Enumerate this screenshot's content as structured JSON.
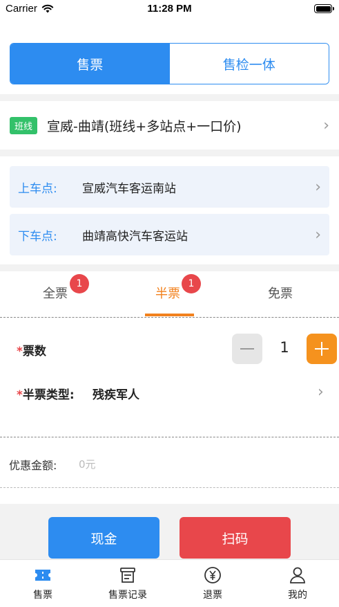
{
  "status_bar": {
    "carrier": "Carrier",
    "time": "11:28 PM"
  },
  "mode_tabs": [
    {
      "label": "售票",
      "active": true
    },
    {
      "label": "售检一体",
      "active": false
    }
  ],
  "route": {
    "tag": "班线",
    "name": "宣威-曲靖(班线+多站点+一口价)"
  },
  "stops": {
    "board_label": "上车点:",
    "board_value": "宣威汽车客运南站",
    "alight_label": "下车点:",
    "alight_value": "曲靖高快汽车客运站"
  },
  "ticket_tabs": [
    {
      "label": "全票",
      "badge": "1",
      "active": false
    },
    {
      "label": "半票",
      "badge": "1",
      "active": true
    },
    {
      "label": "免票",
      "badge": "",
      "active": false
    }
  ],
  "form": {
    "required_mark": "*",
    "count_label": "票数",
    "count_value": "1",
    "half_type_label": "半票类型:",
    "half_type_value": "残疾军人"
  },
  "discount": {
    "label": "优惠金额:",
    "value": "0元"
  },
  "actions": {
    "cash": "现金",
    "scan": "扫码"
  },
  "tabbar": [
    {
      "label": "售票",
      "icon": "ticket-icon",
      "active": true
    },
    {
      "label": "售票记录",
      "icon": "record-icon",
      "active": false
    },
    {
      "label": "退票",
      "icon": "refund-yen-icon",
      "active": false
    },
    {
      "label": "我的",
      "icon": "user-icon",
      "active": false
    }
  ],
  "colors": {
    "primary": "#2d8cf0",
    "accent_orange": "#f2811d",
    "danger": "#e8474b",
    "tag_green": "#33c16a"
  }
}
